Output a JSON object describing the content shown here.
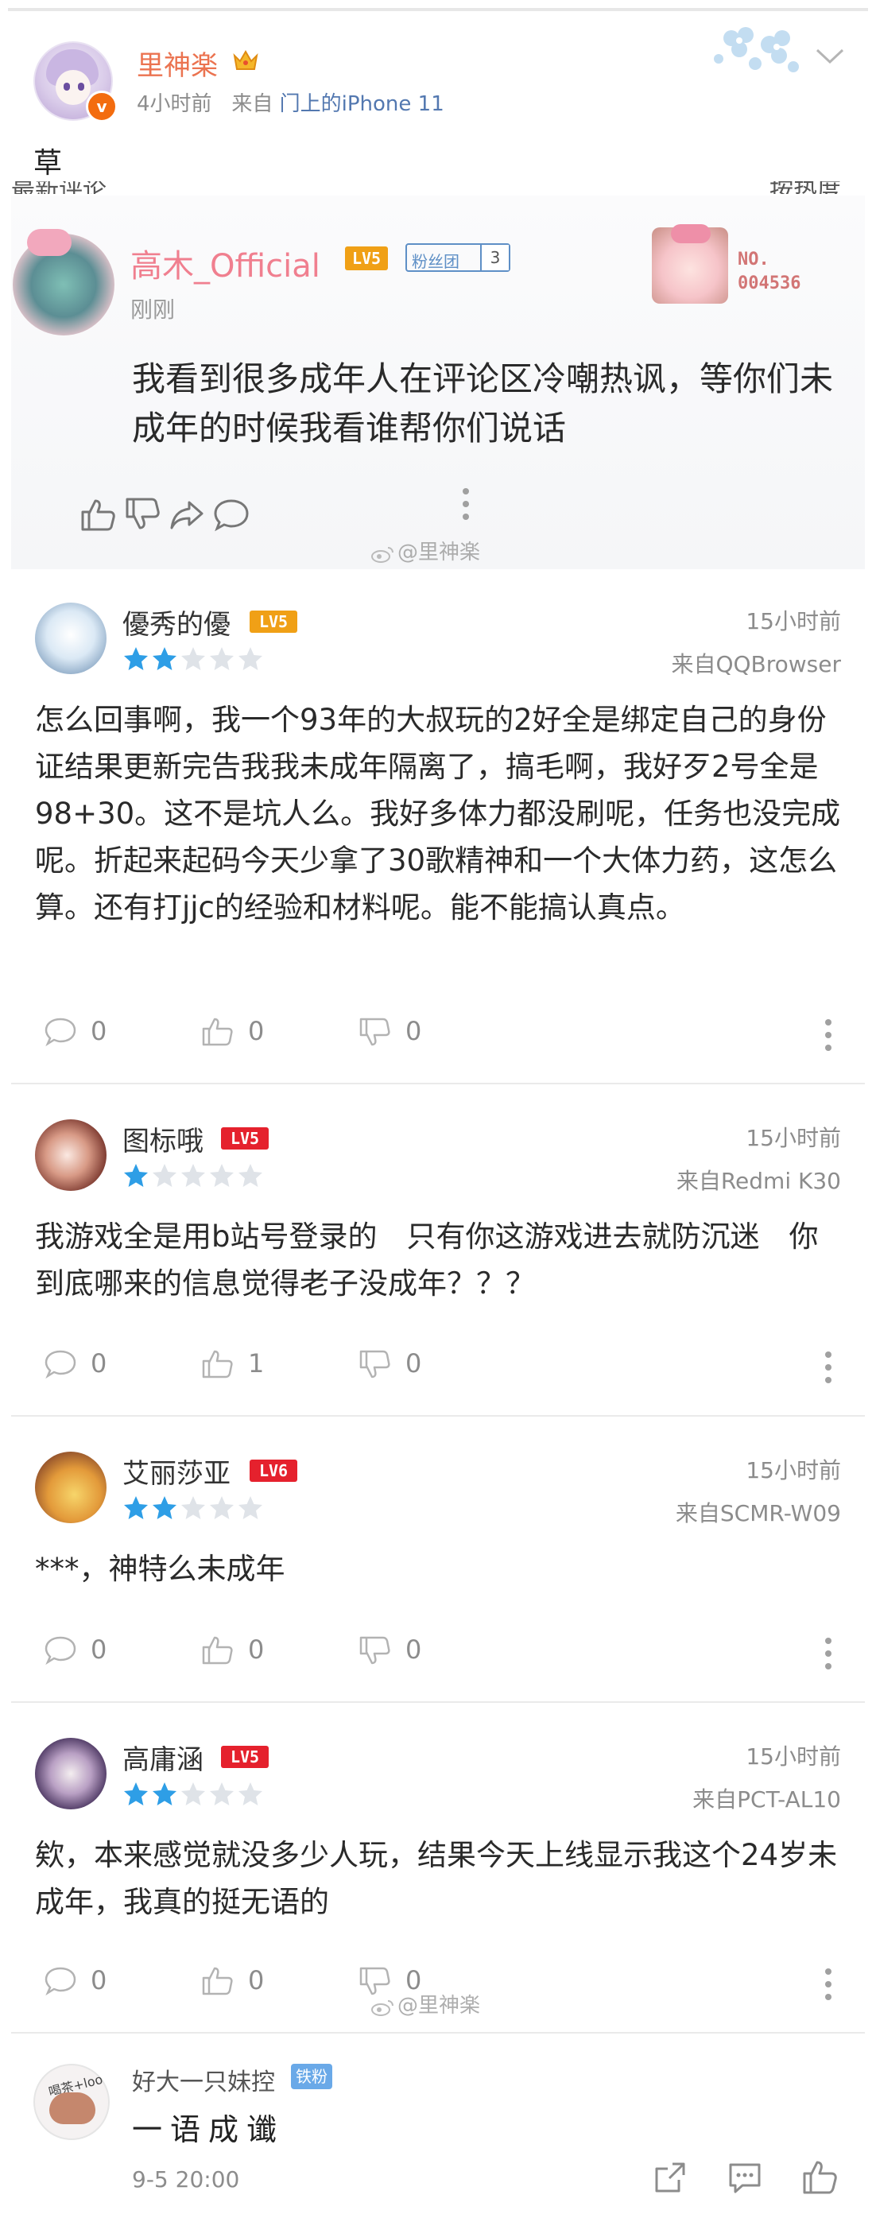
{
  "post": {
    "author": "里神楽",
    "time": "4小时前",
    "source_prefix": "来自",
    "source": "门上的iPhone 11",
    "text": "草"
  },
  "screenshot": {
    "cut_left": "最新评论",
    "cut_right": "按热度",
    "comment": {
      "author": "高木_Official",
      "level": "LV5",
      "fan_label": "粉丝团",
      "fan_level": "3",
      "time": "刚刚",
      "card_no": "NO.",
      "card_id": "004536",
      "body": "我看到很多成年人在评论区冷嘲热讽，等你们未成年的时候我看谁帮你们说话"
    }
  },
  "watermark": "@里神楽",
  "comments": [
    {
      "name": "優秀的優",
      "level": "LV5",
      "time": "15小时前",
      "device": "来自QQBrowser",
      "stars": 2,
      "body": "怎么回事啊，我一个93年的大叔玩的2好全是绑定自己的身份证结果更新完告我我未成年隔离了，搞毛啊，我好歹2号全是98+30。这不是坑人么。我好多体力都没刷呢，任务也没完成呢。折起来起码今天少拿了30歌精神和一个大体力药，这怎么算。还有打jjc的经验和材料呢。能不能搞认真点。",
      "reply_count": "0",
      "like_count": "0",
      "dislike_count": "0"
    },
    {
      "name": "图标哦",
      "level": "LV5",
      "time": "15小时前",
      "device": "来自Redmi K30",
      "stars": 1,
      "body": "我游戏全是用b站号登录的　只有你这游戏进去就防沉迷　你到底哪来的信息觉得老子没成年？？？",
      "reply_count": "0",
      "like_count": "1",
      "dislike_count": "0"
    },
    {
      "name": "艾丽莎亚",
      "level": "LV6",
      "time": "15小时前",
      "device": "来自SCMR-W09",
      "stars": 2,
      "body": "***，神特么未成年",
      "reply_count": "0",
      "like_count": "0",
      "dislike_count": "0"
    },
    {
      "name": "高庸涵",
      "level": "LV5",
      "time": "15小时前",
      "device": "来自PCT-AL10",
      "stars": 2,
      "body": "欸，本来感觉就没多少人玩，结果今天上线显示我这个24岁未成年，我真的挺无语的",
      "reply_count": "0",
      "like_count": "0",
      "dislike_count": "0"
    }
  ],
  "repost": {
    "name": "好大一只妹控",
    "badge": "铁粉",
    "avatar_tag": "喝茶+loo",
    "text": "一语成谶",
    "time": "9-5 20:00"
  },
  "colors": {
    "author_orange": "#eb7350",
    "link_blue": "#5378b0",
    "takagi_pink": "#f07f8f",
    "level_orange": "#f0a016",
    "level_red": "#e5212d",
    "star_blue": "#2e9ee6",
    "star_grey": "#dfe3e8"
  }
}
